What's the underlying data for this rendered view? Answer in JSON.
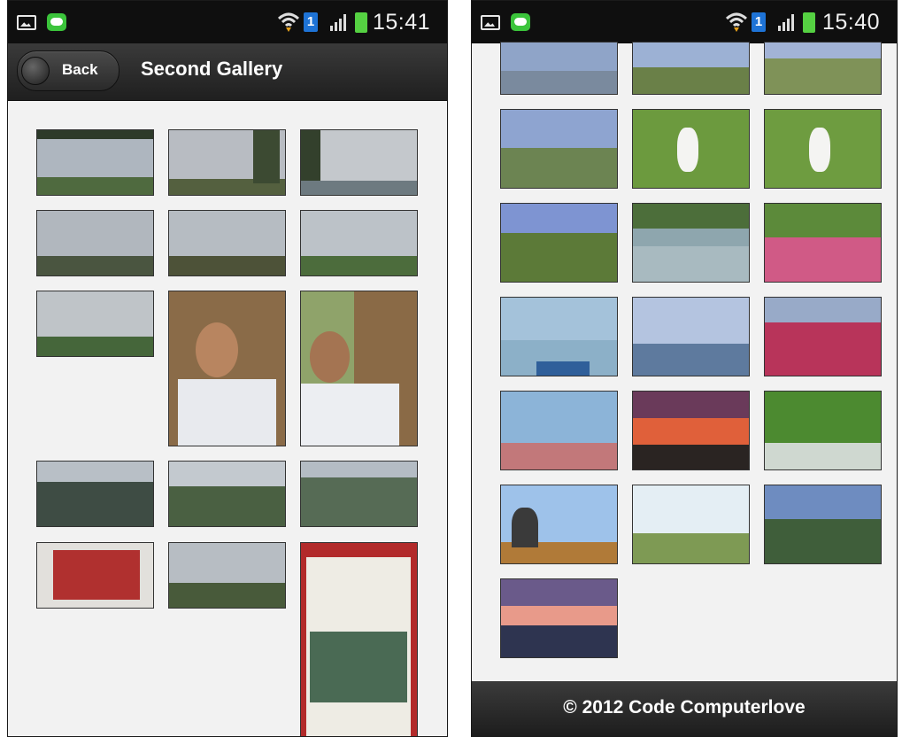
{
  "left": {
    "status": {
      "time": "15:41",
      "sim": "1"
    },
    "header": {
      "back_label": "Back",
      "title": "Second Gallery"
    }
  },
  "right": {
    "status": {
      "time": "15:40",
      "sim": "1"
    },
    "footer": {
      "text": "© 2012 Code Computerlove"
    }
  },
  "colors": {
    "status_bar": "#0f0f0f",
    "header_bar": "#2b2b2b",
    "background": "#f2f2f2",
    "battery": "#55d142",
    "sim_badge": "#1e73d6",
    "line_app": "#3bc43b"
  },
  "icons": [
    "gallery-icon",
    "line-app-icon",
    "wifi-icon",
    "signal-icon",
    "battery-icon",
    "back-icon"
  ]
}
